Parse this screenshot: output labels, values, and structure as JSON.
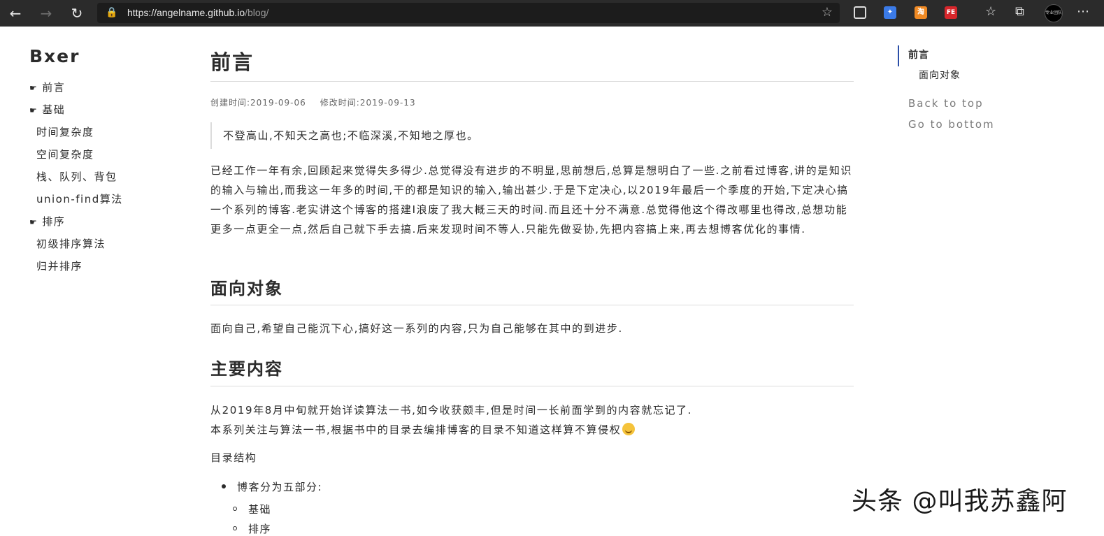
{
  "browser": {
    "url_host": "https://angelname.github.io",
    "url_path": "/blog/",
    "ext_icons": [
      "qr-code-icon",
      "blue-extension-icon",
      "orange-extension-icon",
      "fe-extension-icon"
    ],
    "ext_labels": {
      "orange": "淘",
      "fe": "FE"
    },
    "profile_label": "专业团队"
  },
  "site": {
    "title": "Bxer"
  },
  "sidebar": {
    "items": [
      {
        "label": "前言",
        "level": 1
      },
      {
        "label": "基础",
        "level": 1
      },
      {
        "label": "时间复杂度",
        "level": 2
      },
      {
        "label": "空间复杂度",
        "level": 2
      },
      {
        "label": "栈、队列、背包",
        "level": 2
      },
      {
        "label": "union-find算法",
        "level": 2
      },
      {
        "label": "排序",
        "level": 1
      },
      {
        "label": "初级排序算法",
        "level": 2
      },
      {
        "label": "归并排序",
        "level": 2
      }
    ],
    "bullet": "☛"
  },
  "article": {
    "title": "前言",
    "created": "创建时间:2019-09-06",
    "modified": "修改时间:2019-09-13",
    "quote": "不登高山,不知天之高也;不临深溪,不知地之厚也。",
    "intro": "已经工作一年有余,回顾起来觉得失多得少.总觉得没有进步的不明显,思前想后,总算是想明白了一些.之前看过博客,讲的是知识的输入与输出,而我这一年多的时间,干的都是知识的输入,输出甚少.于是下定决心,以2019年最后一个季度的开始,下定决心搞一个系列的博客.老实讲这个博客的搭建I浪废了我大概三天的时间.而且还十分不满意.总觉得他这个得改哪里也得改,总想功能更多一点更全一点,然后自己就下手去搞.后来发现时间不等人.只能先做妥协,先把内容搞上来,再去想博客优化的事情.",
    "section1_title": "面向对象",
    "section1_text": "面向自己,希望自己能沉下心,搞好这一系列的内容,只为自己能够在其中的到进步.",
    "section2_title": "主要内容",
    "section2_line1": "从2019年8月中旬就开始详读算法一书,如今收获颇丰,但是时间一长前面学到的内容就忘记了.",
    "section2_line2": "本系列关注与算法一书,根据书中的目录去编排博客的目录不知道这样算不算侵权",
    "toc_label": "目录结构",
    "list_top": "博客分为五部分:",
    "list_sub": [
      "基础",
      "排序"
    ]
  },
  "toc": {
    "items": [
      {
        "label": "前言",
        "active": true
      },
      {
        "label": "面向对象",
        "active": false
      }
    ],
    "back_to_top": "Back to top",
    "go_to_bottom": "Go to bottom"
  },
  "watermark": "头条 @叫我苏鑫阿",
  "colors": {
    "chrome": "#2b2b2b",
    "toc_accent": "#2b4fa8",
    "text": "#2b2b2b"
  }
}
